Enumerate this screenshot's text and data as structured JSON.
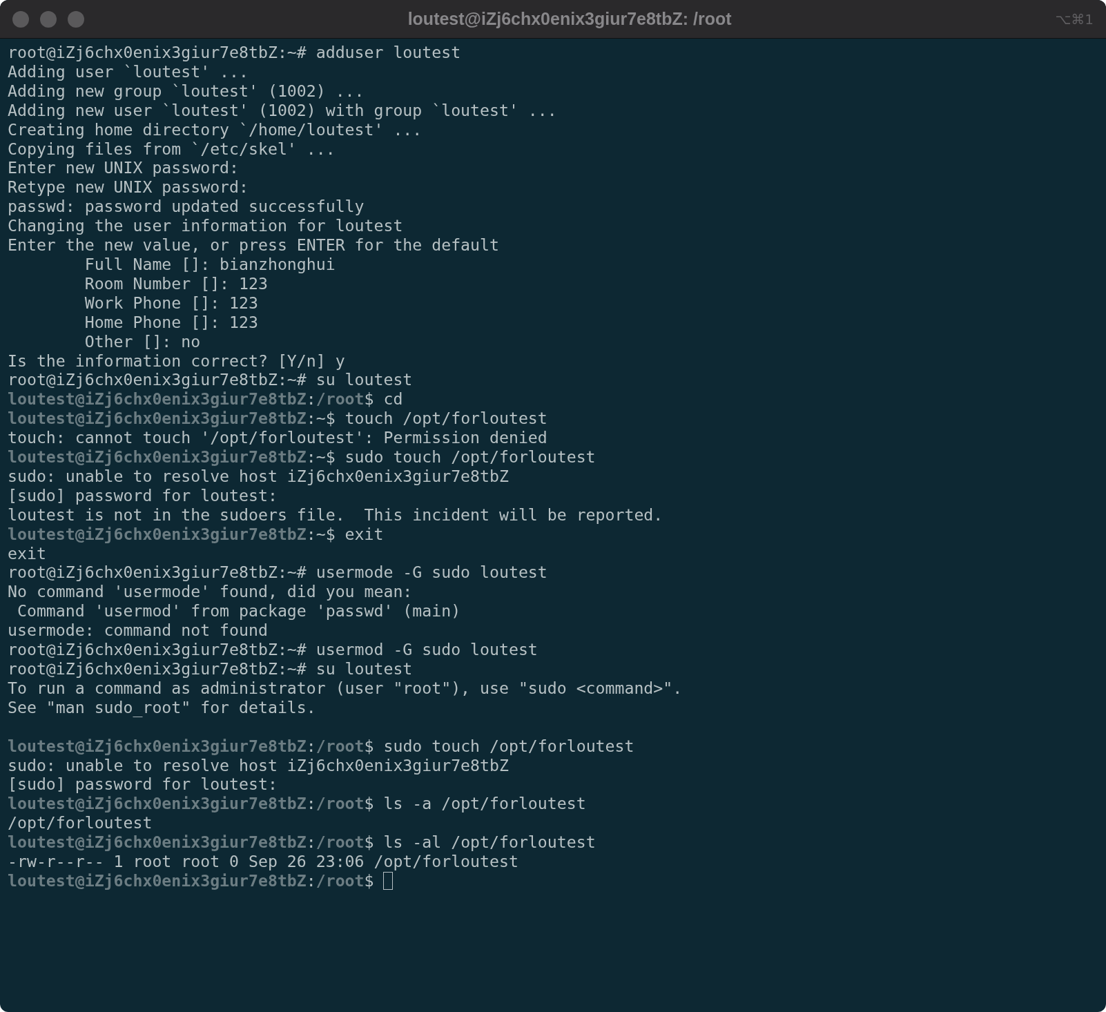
{
  "window": {
    "title": "loutest@iZj6chx0enix3giur7e8tbZ: /root",
    "shortcut": "⌥⌘1"
  },
  "terminal": {
    "cursor_visible": true,
    "blocks": [
      {
        "lines": [
          "root@iZj6chx0enix3giur7e8tbZ:~# adduser loutest",
          "Adding user `loutest' ...",
          "Adding new group `loutest' (1002) ...",
          "Adding new user `loutest' (1002) with group `loutest' ...",
          "Creating home directory `/home/loutest' ...",
          "Copying files from `/etc/skel' ...",
          "Enter new UNIX password:",
          "Retype new UNIX password:",
          "passwd: password updated successfully",
          "Changing the user information for loutest",
          "Enter the new value, or press ENTER for the default",
          "        Full Name []: bianzhonghui",
          "        Room Number []: 123",
          "        Work Phone []: 123",
          "        Home Phone []: 123",
          "        Other []: no",
          "Is the information correct? [Y/n] y",
          "root@iZj6chx0enix3giur7e8tbZ:~# su loutest",
          "**loutest@iZj6chx0enix3giur7e8tbZ**:**/root**$ cd",
          "**loutest@iZj6chx0enix3giur7e8tbZ**:~$ touch /opt/forloutest",
          "touch: cannot touch '/opt/forloutest': Permission denied",
          "**loutest@iZj6chx0enix3giur7e8tbZ**:~$ sudo touch /opt/forloutest",
          "sudo: unable to resolve host iZj6chx0enix3giur7e8tbZ",
          "[sudo] password for loutest:",
          "loutest is not in the sudoers file.  This incident will be reported.",
          "**loutest@iZj6chx0enix3giur7e8tbZ**:~$ exit",
          "exit",
          "root@iZj6chx0enix3giur7e8tbZ:~# usermode -G sudo loutest",
          "No command 'usermode' found, did you mean:",
          " Command 'usermod' from package 'passwd' (main)",
          "usermode: command not found",
          "root@iZj6chx0enix3giur7e8tbZ:~# usermod -G sudo loutest",
          "root@iZj6chx0enix3giur7e8tbZ:~# su loutest",
          "To run a command as administrator (user \"root\"), use \"sudo <command>\".",
          "See \"man sudo_root\" for details."
        ]
      },
      {
        "lines": [
          "**loutest@iZj6chx0enix3giur7e8tbZ**:**/root**$ sudo touch /opt/forloutest",
          "sudo: unable to resolve host iZj6chx0enix3giur7e8tbZ",
          "[sudo] password for loutest:",
          "**loutest@iZj6chx0enix3giur7e8tbZ**:**/root**$ ls -a /opt/forloutest",
          "/opt/forloutest",
          "**loutest@iZj6chx0enix3giur7e8tbZ**:**/root**$ ls -al /opt/forloutest",
          "-rw-r--r-- 1 root root 0 Sep 26 23:06 /opt/forloutest",
          "**loutest@iZj6chx0enix3giur7e8tbZ**:**/root**$ "
        ]
      }
    ]
  }
}
